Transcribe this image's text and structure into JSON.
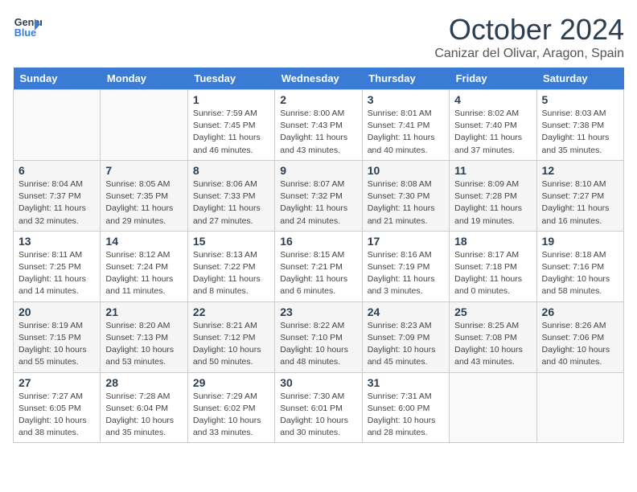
{
  "header": {
    "logo_line1": "General",
    "logo_line2": "Blue",
    "month": "October 2024",
    "location": "Canizar del Olivar, Aragon, Spain"
  },
  "weekdays": [
    "Sunday",
    "Monday",
    "Tuesday",
    "Wednesday",
    "Thursday",
    "Friday",
    "Saturday"
  ],
  "weeks": [
    [
      {
        "day": "",
        "info": ""
      },
      {
        "day": "",
        "info": ""
      },
      {
        "day": "1",
        "info": "Sunrise: 7:59 AM\nSunset: 7:45 PM\nDaylight: 11 hours\nand 46 minutes."
      },
      {
        "day": "2",
        "info": "Sunrise: 8:00 AM\nSunset: 7:43 PM\nDaylight: 11 hours\nand 43 minutes."
      },
      {
        "day": "3",
        "info": "Sunrise: 8:01 AM\nSunset: 7:41 PM\nDaylight: 11 hours\nand 40 minutes."
      },
      {
        "day": "4",
        "info": "Sunrise: 8:02 AM\nSunset: 7:40 PM\nDaylight: 11 hours\nand 37 minutes."
      },
      {
        "day": "5",
        "info": "Sunrise: 8:03 AM\nSunset: 7:38 PM\nDaylight: 11 hours\nand 35 minutes."
      }
    ],
    [
      {
        "day": "6",
        "info": "Sunrise: 8:04 AM\nSunset: 7:37 PM\nDaylight: 11 hours\nand 32 minutes."
      },
      {
        "day": "7",
        "info": "Sunrise: 8:05 AM\nSunset: 7:35 PM\nDaylight: 11 hours\nand 29 minutes."
      },
      {
        "day": "8",
        "info": "Sunrise: 8:06 AM\nSunset: 7:33 PM\nDaylight: 11 hours\nand 27 minutes."
      },
      {
        "day": "9",
        "info": "Sunrise: 8:07 AM\nSunset: 7:32 PM\nDaylight: 11 hours\nand 24 minutes."
      },
      {
        "day": "10",
        "info": "Sunrise: 8:08 AM\nSunset: 7:30 PM\nDaylight: 11 hours\nand 21 minutes."
      },
      {
        "day": "11",
        "info": "Sunrise: 8:09 AM\nSunset: 7:28 PM\nDaylight: 11 hours\nand 19 minutes."
      },
      {
        "day": "12",
        "info": "Sunrise: 8:10 AM\nSunset: 7:27 PM\nDaylight: 11 hours\nand 16 minutes."
      }
    ],
    [
      {
        "day": "13",
        "info": "Sunrise: 8:11 AM\nSunset: 7:25 PM\nDaylight: 11 hours\nand 14 minutes."
      },
      {
        "day": "14",
        "info": "Sunrise: 8:12 AM\nSunset: 7:24 PM\nDaylight: 11 hours\nand 11 minutes."
      },
      {
        "day": "15",
        "info": "Sunrise: 8:13 AM\nSunset: 7:22 PM\nDaylight: 11 hours\nand 8 minutes."
      },
      {
        "day": "16",
        "info": "Sunrise: 8:15 AM\nSunset: 7:21 PM\nDaylight: 11 hours\nand 6 minutes."
      },
      {
        "day": "17",
        "info": "Sunrise: 8:16 AM\nSunset: 7:19 PM\nDaylight: 11 hours\nand 3 minutes."
      },
      {
        "day": "18",
        "info": "Sunrise: 8:17 AM\nSunset: 7:18 PM\nDaylight: 11 hours\nand 0 minutes."
      },
      {
        "day": "19",
        "info": "Sunrise: 8:18 AM\nSunset: 7:16 PM\nDaylight: 10 hours\nand 58 minutes."
      }
    ],
    [
      {
        "day": "20",
        "info": "Sunrise: 8:19 AM\nSunset: 7:15 PM\nDaylight: 10 hours\nand 55 minutes."
      },
      {
        "day": "21",
        "info": "Sunrise: 8:20 AM\nSunset: 7:13 PM\nDaylight: 10 hours\nand 53 minutes."
      },
      {
        "day": "22",
        "info": "Sunrise: 8:21 AM\nSunset: 7:12 PM\nDaylight: 10 hours\nand 50 minutes."
      },
      {
        "day": "23",
        "info": "Sunrise: 8:22 AM\nSunset: 7:10 PM\nDaylight: 10 hours\nand 48 minutes."
      },
      {
        "day": "24",
        "info": "Sunrise: 8:23 AM\nSunset: 7:09 PM\nDaylight: 10 hours\nand 45 minutes."
      },
      {
        "day": "25",
        "info": "Sunrise: 8:25 AM\nSunset: 7:08 PM\nDaylight: 10 hours\nand 43 minutes."
      },
      {
        "day": "26",
        "info": "Sunrise: 8:26 AM\nSunset: 7:06 PM\nDaylight: 10 hours\nand 40 minutes."
      }
    ],
    [
      {
        "day": "27",
        "info": "Sunrise: 7:27 AM\nSunset: 6:05 PM\nDaylight: 10 hours\nand 38 minutes."
      },
      {
        "day": "28",
        "info": "Sunrise: 7:28 AM\nSunset: 6:04 PM\nDaylight: 10 hours\nand 35 minutes."
      },
      {
        "day": "29",
        "info": "Sunrise: 7:29 AM\nSunset: 6:02 PM\nDaylight: 10 hours\nand 33 minutes."
      },
      {
        "day": "30",
        "info": "Sunrise: 7:30 AM\nSunset: 6:01 PM\nDaylight: 10 hours\nand 30 minutes."
      },
      {
        "day": "31",
        "info": "Sunrise: 7:31 AM\nSunset: 6:00 PM\nDaylight: 10 hours\nand 28 minutes."
      },
      {
        "day": "",
        "info": ""
      },
      {
        "day": "",
        "info": ""
      }
    ]
  ]
}
